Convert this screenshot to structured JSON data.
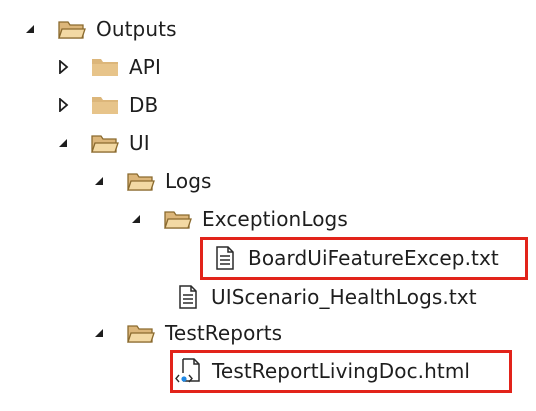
{
  "tree": {
    "items": [
      {
        "label": "Outputs",
        "kind": "folder-open",
        "expanded": true,
        "icon": "folder-open-icon"
      },
      {
        "label": "API",
        "kind": "folder-closed",
        "expanded": false,
        "icon": "folder-icon"
      },
      {
        "label": "DB",
        "kind": "folder-closed",
        "expanded": false,
        "icon": "folder-icon"
      },
      {
        "label": "UI",
        "kind": "folder-open",
        "expanded": true,
        "icon": "folder-open-icon"
      },
      {
        "label": "Logs",
        "kind": "folder-open",
        "expanded": true,
        "icon": "folder-open-icon"
      },
      {
        "label": "ExceptionLogs",
        "kind": "folder-open",
        "expanded": true,
        "icon": "folder-open-icon"
      },
      {
        "label": "BoardUiFeatureExcep.txt",
        "kind": "text-file",
        "icon": "text-file-icon",
        "highlighted": true
      },
      {
        "label": "UIScenario_HealthLogs.txt",
        "kind": "text-file",
        "icon": "text-file-icon",
        "highlighted": false
      },
      {
        "label": "TestReports",
        "kind": "folder-open",
        "expanded": true,
        "icon": "folder-open-icon"
      },
      {
        "label": "TestReportLivingDoc.html",
        "kind": "html-file",
        "icon": "html-file-icon",
        "highlighted": true
      }
    ]
  },
  "colors": {
    "folder_fill": "#dcb67a",
    "folder_dark": "#c29a52",
    "folder_outline": "#8a6a2e",
    "highlight_border": "#e2231a",
    "text": "#1e1e1e",
    "toggle": "#1e1e1e",
    "html_badge": "#1e88e5"
  }
}
